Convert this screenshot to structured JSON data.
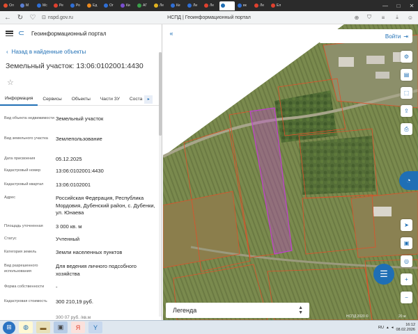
{
  "browser": {
    "tabs": [
      {
        "label": "Ол",
        "color": "#e54d2e"
      },
      {
        "label": "М",
        "color": "#5b7fd3"
      },
      {
        "label": "Мс",
        "color": "#2f6fd6"
      },
      {
        "label": "Ре",
        "color": "#e0412f"
      },
      {
        "label": "Ро",
        "color": "#2f6fd6"
      },
      {
        "label": "Ед",
        "color": "#ec8a1f"
      },
      {
        "label": "Ог",
        "color": "#2f6fd6"
      },
      {
        "label": "Ки",
        "color": "#7a4fd0"
      },
      {
        "label": "АГ",
        "color": "#3aa04a"
      },
      {
        "label": "Ле",
        "color": "#e0b21f"
      },
      {
        "label": "Ке",
        "color": "#2f6fd6"
      },
      {
        "label": "Ли",
        "color": "#2f6fd6"
      },
      {
        "label": "Ле",
        "color": "#e0412f"
      },
      {
        "label": "",
        "color": "#1f6fb5"
      },
      {
        "label": "вк",
        "color": "#2f6fd6"
      },
      {
        "label": "Ле",
        "color": "#e0412f"
      },
      {
        "label": "Ел",
        "color": "#e0412f"
      }
    ],
    "active_tab_index": 13,
    "url": "nspd.gov.ru",
    "page_title": "НСПД | Геоинформационный портал"
  },
  "panel": {
    "portal_name": "Геоинформационный портал",
    "back_link": "Назад в найденные объекты",
    "object_title": "Земельный участок: 13:06:0102001:4430",
    "tabs": [
      "Информация",
      "Сервисы",
      "Объекты",
      "Части ЗУ",
      "Соста"
    ],
    "active_tab": 0,
    "rows": [
      {
        "label": "Вид объекта недвижимости",
        "value": "Земельный участок"
      },
      {
        "label": "Вид земельного участка",
        "value": "Землепользование"
      },
      {
        "label": "Дата присвоения",
        "value": "05.12.2025"
      },
      {
        "label": "Кадастровый номер",
        "value": "13:06:0102001:4430"
      },
      {
        "label": "Кадастровый квартал",
        "value": "13:06:0102001"
      },
      {
        "label": "Адрес",
        "value": "Российская Федерация, Республика Мордовия, Дубенский район, с. Дубенки, ул. Юнаева"
      },
      {
        "label": "Площадь уточненная",
        "value": "3 000 кв. м"
      },
      {
        "label": "Статус",
        "value": "Учтенный"
      },
      {
        "label": "Категория земель",
        "value": "Земли населенных пунктов"
      },
      {
        "label": "Вид разрешенного использования",
        "value": "Для ведения личного подсобного хозяйства"
      },
      {
        "label": "Форма собственности",
        "value": "-"
      },
      {
        "label": "Кадастровая стоимость",
        "value": "300 210,19 руб."
      },
      {
        "label": "",
        "value": "300 07 руб. /кв.м"
      }
    ]
  },
  "map": {
    "login_label": "Войти",
    "legend_label": "Легенда",
    "attribution": "НСПД 2020 ©",
    "scale": "20 м",
    "colors": {
      "parcel_outline": "#e0502a",
      "selected_parcel": "#c040d0",
      "accent": "#1f6fb5"
    }
  },
  "taskbar": {
    "lang": "RU",
    "time": "16:12",
    "date": "08.02.2026"
  }
}
